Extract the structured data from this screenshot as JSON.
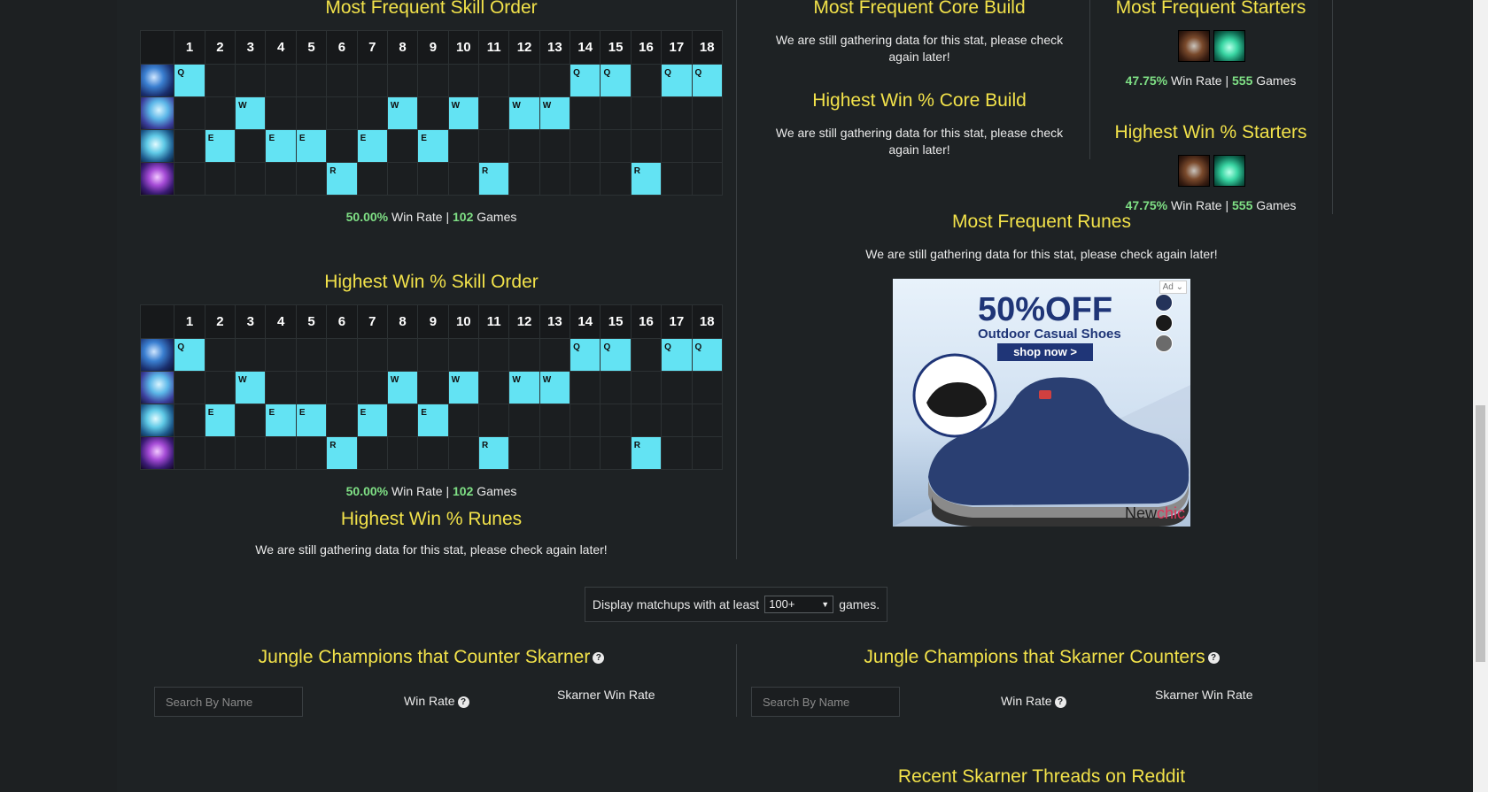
{
  "skill_order_frequent": {
    "title": "Most Frequent Skill Order",
    "levels": [
      "1",
      "2",
      "3",
      "4",
      "5",
      "6",
      "7",
      "8",
      "9",
      "10",
      "11",
      "12",
      "13",
      "14",
      "15",
      "16",
      "17",
      "18"
    ],
    "rows": [
      {
        "ability": "Q",
        "icon": "skarner-q-icon",
        "levels": [
          1,
          14,
          15,
          17,
          18
        ]
      },
      {
        "ability": "W",
        "icon": "skarner-w-icon",
        "levels": [
          3,
          8,
          10,
          12,
          13
        ]
      },
      {
        "ability": "E",
        "icon": "skarner-e-icon",
        "levels": [
          2,
          4,
          5,
          7,
          9
        ]
      },
      {
        "ability": "R",
        "icon": "skarner-r-icon",
        "levels": [
          6,
          11,
          16
        ]
      }
    ],
    "win_rate": "50.00%",
    "win_rate_label": "Win Rate |",
    "games": "102",
    "games_label": "Games"
  },
  "skill_order_highest": {
    "title": "Highest Win % Skill Order",
    "levels": [
      "1",
      "2",
      "3",
      "4",
      "5",
      "6",
      "7",
      "8",
      "9",
      "10",
      "11",
      "12",
      "13",
      "14",
      "15",
      "16",
      "17",
      "18"
    ],
    "rows": [
      {
        "ability": "Q",
        "icon": "skarner-q-icon",
        "levels": [
          1,
          14,
          15,
          17,
          18
        ]
      },
      {
        "ability": "W",
        "icon": "skarner-w-icon",
        "levels": [
          3,
          8,
          10,
          12,
          13
        ]
      },
      {
        "ability": "E",
        "icon": "skarner-e-icon",
        "levels": [
          2,
          4,
          5,
          7,
          9
        ]
      },
      {
        "ability": "R",
        "icon": "skarner-r-icon",
        "levels": [
          6,
          11,
          16
        ]
      }
    ],
    "win_rate": "50.00%",
    "win_rate_label": "Win Rate |",
    "games": "102",
    "games_label": "Games"
  },
  "highest_runes": {
    "title": "Highest Win % Runes",
    "text": "We are still gathering data for this stat, please check again later!"
  },
  "core_build_frequent": {
    "title": "Most Frequent Core Build",
    "text": "We are still gathering data for this stat, please check again later!"
  },
  "core_build_highest": {
    "title": "Highest Win % Core Build",
    "text": "We are still gathering data for this stat, please check again later!"
  },
  "starters_frequent": {
    "title": "Most Frequent Starters",
    "items": [
      "hailblade-icon",
      "refillable-potion-icon"
    ],
    "win_rate": "47.75%",
    "win_rate_label": "Win Rate |",
    "games": "555",
    "games_label": "Games"
  },
  "starters_highest": {
    "title": "Highest Win % Starters",
    "items": [
      "hailblade-icon",
      "refillable-potion-icon"
    ],
    "win_rate": "47.75%",
    "win_rate_label": "Win Rate |",
    "games": "555",
    "games_label": "Games"
  },
  "frequent_runes": {
    "title": "Most Frequent Runes",
    "text": "We are still gathering data for this stat, please check again later!"
  },
  "ad": {
    "badge": "Ad",
    "headline": "50%OFF",
    "sub": "Outdoor Casual Shoes",
    "cta": "shop now >",
    "brand_a": "New",
    "brand_b": "chic"
  },
  "filter": {
    "prefix": "Display matchups with at least",
    "selected": "100+",
    "suffix": "games."
  },
  "counters_left": {
    "title": "Jungle Champions that Counter Skarner",
    "search_placeholder": "Search By Name",
    "col_winrate": "Win Rate",
    "col_champ_winrate": "Skarner Win Rate"
  },
  "counters_right": {
    "title": "Jungle Champions that Skarner Counters",
    "search_placeholder": "Search By Name",
    "col_winrate": "Win Rate",
    "col_champ_winrate": "Skarner Win Rate"
  },
  "reddit": {
    "title": "Recent Skarner Threads on Reddit"
  },
  "help_glyph": "?",
  "colors": {
    "title": "#f2e24a",
    "skill_on": "#63e3f3",
    "win_green": "#7fe085"
  }
}
